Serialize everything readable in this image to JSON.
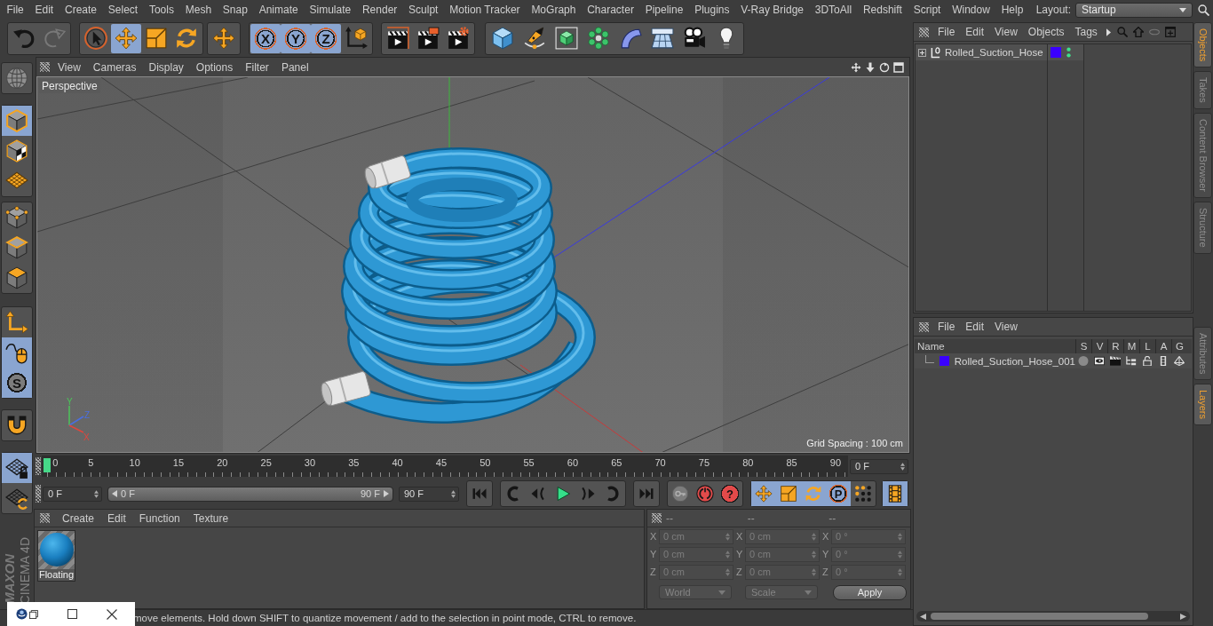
{
  "menu_bar": {
    "items": [
      "File",
      "Edit",
      "Create",
      "Select",
      "Tools",
      "Mesh",
      "Snap",
      "Animate",
      "Simulate",
      "Render",
      "Sculpt",
      "Motion Tracker",
      "MoGraph",
      "Character",
      "Pipeline",
      "Plugins",
      "V-Ray Bridge",
      "3DToAll",
      "Redshift",
      "Script",
      "Window",
      "Help"
    ],
    "layout_label": "Layout:",
    "layout_value": "Startup"
  },
  "toolbar": {
    "groups": [
      [
        {
          "kind": "undo",
          "selected": false,
          "disabled": false
        },
        {
          "kind": "redo",
          "selected": false,
          "disabled": true
        }
      ],
      [
        {
          "kind": "select",
          "selected": false
        },
        {
          "kind": "move",
          "selected": true
        },
        {
          "kind": "scale",
          "selected": false
        },
        {
          "kind": "rotate",
          "selected": false
        }
      ],
      [
        {
          "kind": "transform",
          "selected": false
        }
      ],
      [
        {
          "kind": "axislock",
          "label": "X",
          "selected": true
        },
        {
          "kind": "axislock",
          "label": "Y",
          "selected": true
        },
        {
          "kind": "axislock",
          "label": "Z",
          "selected": true
        },
        {
          "kind": "coordsystem",
          "selected": false
        }
      ],
      [
        {
          "kind": "renderview",
          "selected": false
        },
        {
          "kind": "renderpicture",
          "selected": false
        },
        {
          "kind": "rendersettings",
          "selected": false
        }
      ],
      [
        {
          "kind": "cube",
          "selected": false
        },
        {
          "kind": "pen",
          "selected": false
        },
        {
          "kind": "subdivision",
          "selected": false
        },
        {
          "kind": "cloner",
          "selected": false
        },
        {
          "kind": "bend",
          "selected": false
        },
        {
          "kind": "floor",
          "selected": false
        },
        {
          "kind": "camera",
          "selected": false
        },
        {
          "kind": "light",
          "selected": false
        }
      ]
    ]
  },
  "left_toolbar": {
    "groups": [
      [
        {
          "kind": "editable",
          "selected": false
        }
      ],
      [
        {
          "kind": "model",
          "selected": true
        },
        {
          "kind": "texture",
          "selected": false
        },
        {
          "kind": "workplane",
          "selected": false
        }
      ],
      [
        {
          "kind": "points",
          "selected": false
        },
        {
          "kind": "edges",
          "selected": false
        },
        {
          "kind": "polygons",
          "selected": false
        }
      ],
      [
        {
          "kind": "axis",
          "selected": false
        },
        {
          "kind": "tweak",
          "selected": true
        },
        {
          "kind": "solo",
          "label": "S",
          "selected": true
        }
      ],
      [
        {
          "kind": "snap",
          "selected": false
        }
      ],
      [
        {
          "kind": "lockplane",
          "selected": true
        },
        {
          "kind": "planarplane",
          "selected": false
        }
      ]
    ]
  },
  "logo": {
    "brand": "MAXON",
    "product": "CINEMA 4D"
  },
  "viewport": {
    "menu": [
      "View",
      "Cameras",
      "Display",
      "Options",
      "Filter",
      "Panel"
    ],
    "camera_label": "Perspective",
    "grid_spacing": "Grid Spacing : 100 cm",
    "axis_gizmo": [
      {
        "kind": "y",
        "label": "Y"
      },
      {
        "kind": "z",
        "label": "Z"
      },
      {
        "kind": "x",
        "label": "X"
      }
    ]
  },
  "timeline": {
    "ticks": [
      "0",
      "5",
      "10",
      "15",
      "20",
      "25",
      "30",
      "35",
      "40",
      "45",
      "50",
      "55",
      "60",
      "65",
      "70",
      "75",
      "80",
      "85",
      "90"
    ],
    "playhead": {
      "level": 0
    },
    "current_frame": "0 F"
  },
  "transport": {
    "start_field": "0 F",
    "range": {
      "level": 1
    },
    "range_start": "0 F",
    "range_end": "90 F",
    "end_field": "90 F",
    "groups": [
      [
        {
          "kind": "first",
          "selected": false
        }
      ],
      [
        {
          "kind": "prevkey",
          "selected": false
        },
        {
          "kind": "prevframe",
          "selected": false
        },
        {
          "kind": "play",
          "selected": false
        },
        {
          "kind": "nextframe",
          "selected": false
        },
        {
          "kind": "nextkey",
          "selected": false
        }
      ],
      [
        {
          "kind": "last",
          "selected": false
        }
      ],
      [
        {
          "kind": "record",
          "selected": false,
          "disabled": true
        },
        {
          "kind": "autokey",
          "selected": false,
          "disabled": false
        },
        {
          "kind": "help",
          "label": "?",
          "selected": false,
          "disabled": false
        }
      ],
      [
        {
          "kind": "move",
          "selected": true
        },
        {
          "kind": "scale",
          "selected": true
        },
        {
          "kind": "rotate",
          "selected": true
        },
        {
          "kind": "param",
          "label": "P",
          "selected": true
        },
        {
          "kind": "pla",
          "selected": false
        }
      ],
      [
        {
          "kind": "timeline",
          "selected": true
        }
      ]
    ]
  },
  "material_manager": {
    "menu": [
      "Create",
      "Edit",
      "Function",
      "Texture"
    ],
    "materials": [
      {
        "name": "Floating"
      }
    ]
  },
  "coordinates": {
    "headers": [
      "--",
      "--",
      "--"
    ],
    "rows": [
      [
        {
          "label": "X",
          "value": "0 cm",
          "disabled": true
        },
        {
          "label": "X",
          "value": "0 cm",
          "disabled": true
        },
        {
          "label": "X",
          "value": "0 °",
          "disabled": true
        }
      ],
      [
        {
          "label": "Y",
          "value": "0 cm",
          "disabled": true
        },
        {
          "label": "Y",
          "value": "0 cm",
          "disabled": true
        },
        {
          "label": "Y",
          "value": "0 °",
          "disabled": true
        }
      ],
      [
        {
          "label": "Z",
          "value": "0 cm",
          "disabled": true
        },
        {
          "label": "Z",
          "value": "0 cm",
          "disabled": true
        },
        {
          "label": "Z",
          "value": "0 °",
          "disabled": true
        }
      ]
    ],
    "dropdowns": [
      {
        "value": "World",
        "disabled": true
      },
      {
        "value": "Scale",
        "disabled": true
      }
    ],
    "apply": {
      "label": "Apply",
      "disabled": false
    }
  },
  "object_manager": {
    "menu": [
      "File",
      "Edit",
      "View",
      "Objects",
      "Tags"
    ],
    "objects": [
      {
        "name": "Rolled_Suction_Hose",
        "expanded": false,
        "color": "#3a00ff"
      }
    ]
  },
  "layer_manager": {
    "menu": [
      "File",
      "Edit",
      "View"
    ],
    "columns": [
      "Name",
      "S",
      "V",
      "R",
      "M",
      "L",
      "A",
      "G"
    ],
    "layers": [
      {
        "name": "Rolled_Suction_Hose_001",
        "color": "#3a00ff"
      }
    ]
  },
  "side_tabs": {
    "top": [
      {
        "label": "Objects",
        "selected": true
      },
      {
        "label": "Takes",
        "selected": false
      },
      {
        "label": "Content Browser",
        "selected": false
      },
      {
        "label": "Structure",
        "selected": false
      }
    ],
    "bottom": [
      {
        "label": "Attributes",
        "selected": false
      },
      {
        "label": "Layers",
        "selected": true
      }
    ]
  },
  "status_bar": {
    "text": "move elements. Hold down SHIFT to quantize movement / add to the selection in point mode, CTRL to remove."
  }
}
